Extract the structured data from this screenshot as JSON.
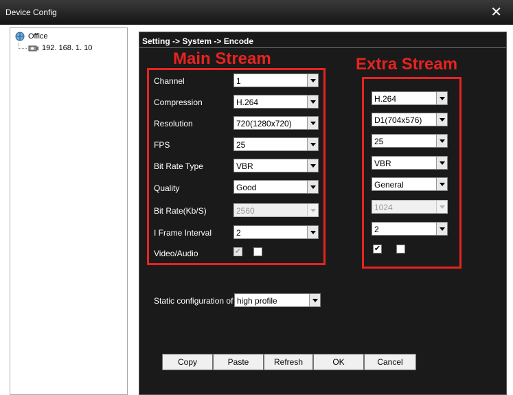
{
  "window": {
    "title": "Device Config",
    "close_glyph": "✕"
  },
  "tree": {
    "root": "Office",
    "child": "192. 168. 1. 10"
  },
  "breadcrumb": "Setting -> System -> Encode",
  "headings": {
    "main": "Main Stream",
    "extra": "Extra Stream"
  },
  "labels": {
    "channel": "Channel",
    "compression": "Compression",
    "resolution": "Resolution",
    "fps": "FPS",
    "bitrate_type": "Bit Rate Type",
    "quality": "Quality",
    "bitrate": "Bit Rate(Kb/S)",
    "iframe": "I Frame Interval",
    "video_audio": "Video/Audio",
    "static_config": "Static configuration of"
  },
  "main": {
    "channel": "1",
    "compression": "H.264",
    "resolution": "720(1280x720)",
    "fps": "25",
    "bitrate_type": "VBR",
    "quality": "Good",
    "bitrate": "2560",
    "iframe": "2",
    "video_checked": true,
    "audio_checked": false
  },
  "extra": {
    "compression": "H.264",
    "resolution": "D1(704x576)",
    "fps": "25",
    "bitrate_type": "VBR",
    "quality": "General",
    "bitrate": "1024",
    "iframe": "2",
    "video_checked": true,
    "audio_checked": false
  },
  "static_config_value": "high profile",
  "check_glyph": "✔",
  "buttons": {
    "copy": "Copy",
    "paste": "Paste",
    "refresh": "Refresh",
    "ok": "OK",
    "cancel": "Cancel"
  },
  "colors": {
    "highlight": "#e8231f",
    "panel_bg": "#1a1a1a"
  },
  "icons": {
    "root": "network-group-icon",
    "child": "camera-device-icon",
    "close": "close-icon"
  }
}
